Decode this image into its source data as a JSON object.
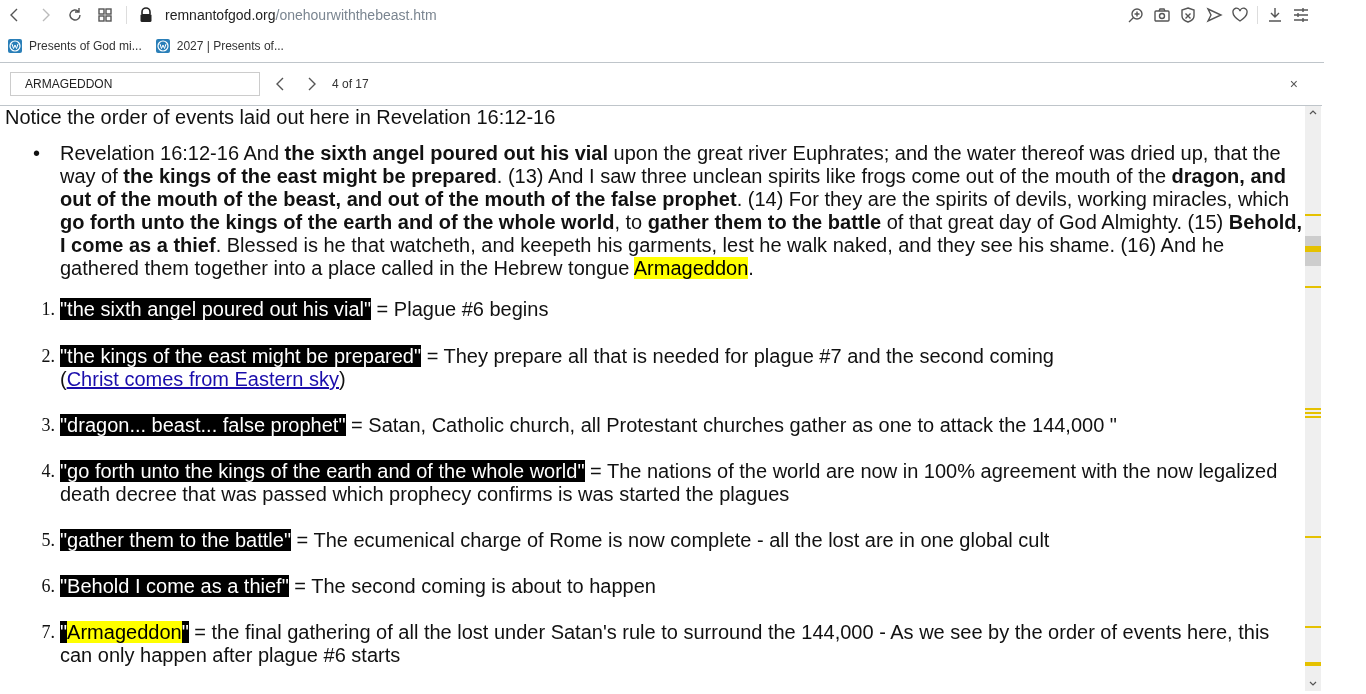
{
  "browser": {
    "url_domain": "remnantofgod.org",
    "url_path": "/onehourwiththebeast.htm",
    "bookmarks": [
      {
        "label": "Presents of God mi..."
      },
      {
        "label": "2027 | Presents of..."
      }
    ]
  },
  "find_bar": {
    "query": "ARMAGEDDON",
    "count": "4 of 17",
    "close": "×"
  },
  "content": {
    "intro": "Notice the order of events laid out here in Revelation 16:12-16",
    "bullet": {
      "marker": "•",
      "text": "Revelation 16:12-16  And **the sixth angel poured out his vial** upon the great river Euphrates; and the water thereof was dried up, that the way of **the kings of the east might be prepared**.  (13)  And I saw three unclean spirits like frogs come out of the mouth of the **dragon, and out of the mouth of the beast, and out of the mouth of the false prophet**.  (14)  For they are the spirits of devils, working miracles, which **go forth unto the kings of the earth and of the whole world**, to **gather them to the battle** of that great day of God Almighty.  (15)  **Behold, I come as a thief**. Blessed is he that watcheth, and keepeth his garments, lest he walk naked, and they see his shame.  (16)  And he gathered them together into a place called in the Hebrew tongue ",
      "match": "Armageddon",
      "after": "."
    },
    "items": [
      {
        "number": "1.",
        "quote": [
          {
            "text": "\"the sixth angel poured out his vial\"",
            "match": false
          }
        ],
        "text": " = Plague #6 begins"
      },
      {
        "number": "2.",
        "quote": [
          {
            "text": "\"the kings of the east might be prepared\"",
            "match": false
          }
        ],
        "text": " = They prepare all that is needed for plague #7 and the second coming (",
        "link": "Christ comes from Eastern sky",
        "after": ")"
      },
      {
        "number": "3.",
        "quote": [
          {
            "text": "\"dragon... beast... false prophet\"",
            "match": false
          }
        ],
        "text": " = Satan, Catholic church, all Protestant churches gather as one to attack the 144,000 \""
      },
      {
        "number": "4.",
        "quote": [
          {
            "text": "\"go forth unto the kings of the earth and of the whole world\"",
            "match": false
          }
        ],
        "text": " = The nations of the world are now in 100% agreement with the now legalized death decree that was passed which prophecy confirms is was started the plagues"
      },
      {
        "number": "5.",
        "quote": [
          {
            "text": "\"gather them to the battle\"",
            "match": false
          }
        ],
        "text": " = The ecumenical charge of Rome is now complete - all the lost are in one global cult"
      },
      {
        "number": "6.",
        "quote": [
          {
            "text": "\"Behold I come as a thief\"",
            "match": false
          }
        ],
        "text": " = The second coming is about to happen"
      },
      {
        "number": "7.",
        "quote": [
          {
            "text": "\"",
            "match": false
          },
          {
            "text": "Armageddon",
            "match": true
          },
          {
            "text": "\"",
            "match": false
          }
        ],
        "text": " = the final gathering of all the lost under Satan's rule to surround the 144,000 - As we see by the order of events here, this can only happen after plague #6 starts"
      }
    ]
  }
}
